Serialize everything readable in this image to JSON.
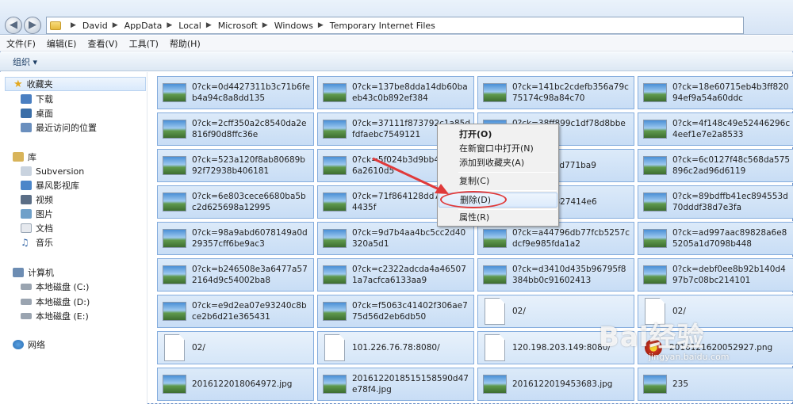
{
  "address": {
    "crumbs": [
      "David",
      "AppData",
      "Local",
      "Microsoft",
      "Windows",
      "Temporary Internet Files"
    ]
  },
  "menu": [
    "文件(F)",
    "编辑(E)",
    "查看(V)",
    "工具(T)",
    "帮助(H)"
  ],
  "toolbar": {
    "organize": "组织"
  },
  "sidebar": {
    "favorites": "收藏夹",
    "fav_items": [
      "下载",
      "桌面",
      "最近访问的位置"
    ],
    "library": "库",
    "lib_items": [
      "Subversion",
      "暴风影视库",
      "视频",
      "图片",
      "文档",
      "音乐"
    ],
    "computer": "计算机",
    "drives": [
      "本地磁盘 (C:)",
      "本地磁盘 (D:)",
      "本地磁盘 (E:)"
    ],
    "network": "网络"
  },
  "files": [
    {
      "name": "0?ck=0d4427311b3c71b6feb4a94c8a8dd135",
      "kind": "img"
    },
    {
      "name": "0?ck=137be8dda14db60baeb43c0b892ef384",
      "kind": "img"
    },
    {
      "name": "0?ck=141bc2cdefb356a79c75174c98a84c70",
      "kind": "img"
    },
    {
      "name": "0?ck=18e60715eb4b3ff82094ef9a54a60ddc",
      "kind": "img"
    },
    {
      "name": "0?ck=2cff350a2c8540da2e816f90d8ffc36e",
      "kind": "img"
    },
    {
      "name": "0?ck=37111f873792c1a85dfdfaebc7549121",
      "kind": "img"
    },
    {
      "name": "0?ck=38ff899c1df78d8bbeb03e",
      "kind": "img"
    },
    {
      "name": "0?ck=4f148c49e52446296c4eef1e7e2a8533",
      "kind": "img"
    },
    {
      "name": "0?ck=523a120f8ab80689b92f72938b406181",
      "kind": "img"
    },
    {
      "name": "0?ck=5f024b3d9bb4571726a2610d5",
      "kind": "img"
    },
    {
      "name": "88cfefbba2d771ba9",
      "kind": "img"
    },
    {
      "name": "0?ck=6c0127f48c568da575896c2ad96d6119",
      "kind": "img"
    },
    {
      "name": "0?ck=6e803cece6680ba5bc2d625698a12995",
      "kind": "img"
    },
    {
      "name": "0?ck=71f864128dd7faa6134435f",
      "kind": "img"
    },
    {
      "name": "08579485827414e6",
      "kind": "img"
    },
    {
      "name": "0?ck=89bdffb41ec894553d70dddf38d7e3fa",
      "kind": "img"
    },
    {
      "name": "0?ck=98a9abd6078149a0d29357cff6be9ac3",
      "kind": "img"
    },
    {
      "name": "0?ck=9d7b4aa4bc5cc2d40320a5d1",
      "kind": "img"
    },
    {
      "name": "0?ck=a44796db77fcb5257cdcf9e985fda1a2",
      "kind": "img"
    },
    {
      "name": "0?ck=ad997aac89828a6e85205a1d7098b448",
      "kind": "img"
    },
    {
      "name": "0?ck=b246508e3a6477a572164d9c54002ba8",
      "kind": "img"
    },
    {
      "name": "0?ck=c2322adcda4a465071a7acfca6133aa9",
      "kind": "img"
    },
    {
      "name": "0?ck=d3410d435b96795f8384bb0c91602413",
      "kind": "img"
    },
    {
      "name": "0?ck=debf0ee8b92b140d497b7c08bc214101",
      "kind": "img"
    },
    {
      "name": "0?ck=e9d2ea07e93240c8bce2b6d21e365431",
      "kind": "img"
    },
    {
      "name": "0?ck=f5063c41402f306ae775d56d2eb6db50",
      "kind": "img"
    },
    {
      "name": "02/",
      "kind": "doc"
    },
    {
      "name": "02/",
      "kind": "doc"
    },
    {
      "name": "02/",
      "kind": "doc"
    },
    {
      "name": "101.226.76.78:8080/",
      "kind": "doc"
    },
    {
      "name": "120.198.203.149:8080/",
      "kind": "doc"
    },
    {
      "name": "2016121620052927.png",
      "kind": "flower"
    },
    {
      "name": "2016122018064972.jpg",
      "kind": "img"
    },
    {
      "name": "2016122018515158590d47e78f4.jpg",
      "kind": "img"
    },
    {
      "name": "2016122019453683.jpg",
      "kind": "img"
    },
    {
      "name": "235",
      "kind": "img"
    }
  ],
  "context_menu": {
    "open": "打开(O)",
    "open_new_window": "在新窗口中打开(N)",
    "add_favorites": "添加到收藏夹(A)",
    "copy": "复制(C)",
    "delete": "删除(D)",
    "properties": "属性(R)"
  },
  "watermark": {
    "main": "Bai经验",
    "sub": "jingyan.baidu.com"
  },
  "colors": {
    "selection": "#c8ddf5",
    "annotation": "#e03a3a"
  }
}
